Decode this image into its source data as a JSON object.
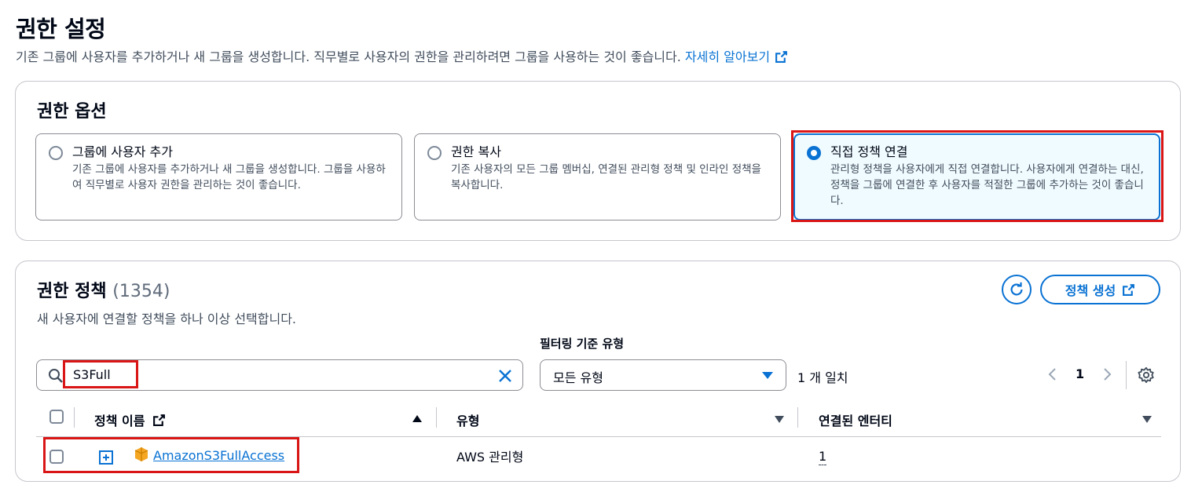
{
  "header": {
    "title": "권한 설정",
    "description": "기존 그룹에 사용자를 추가하거나 새 그룹을 생성합니다. 직무별로 사용자의 권한을 관리하려면 그룹을 사용하는 것이 좋습니다.",
    "learn_more": "자세히 알아보기"
  },
  "options": {
    "title": "권한 옵션",
    "items": [
      {
        "title": "그룹에 사용자 추가",
        "desc": "기존 그룹에 사용자를 추가하거나 새 그룹을 생성합니다. 그룹을 사용하여 직무별로 사용자 권한을 관리하는 것이 좋습니다.",
        "selected": false
      },
      {
        "title": "권한 복사",
        "desc": "기존 사용자의 모든 그룹 멤버십, 연결된 관리형 정책 및 인라인 정책을 복사합니다.",
        "selected": false
      },
      {
        "title": "직접 정책 연결",
        "desc": "관리형 정책을 사용자에게 직접 연결합니다. 사용자에게 연결하는 대신, 정책을 그룹에 연결한 후 사용자를 적절한 그룹에 추가하는 것이 좋습니다.",
        "selected": true
      }
    ]
  },
  "policies": {
    "title": "권한 정책",
    "count": "(1354)",
    "description": "새 사용자에 연결할 정책을 하나 이상 선택합니다.",
    "create_button": "정책 생성",
    "filter_label": "필터링 기준 유형",
    "search_value": "S3Full",
    "type_select": "모든 유형",
    "match_count": "1 개 일치",
    "page": "1",
    "columns": {
      "name": "정책 이름",
      "type": "유형",
      "entities": "연결된 엔터티"
    },
    "rows": [
      {
        "name": "AmazonS3FullAccess",
        "type": "AWS 관리형",
        "entities": "1"
      }
    ]
  },
  "colors": {
    "accent": "#0972d3",
    "highlight": "#d91515",
    "aws_orange": "#f5a623"
  }
}
